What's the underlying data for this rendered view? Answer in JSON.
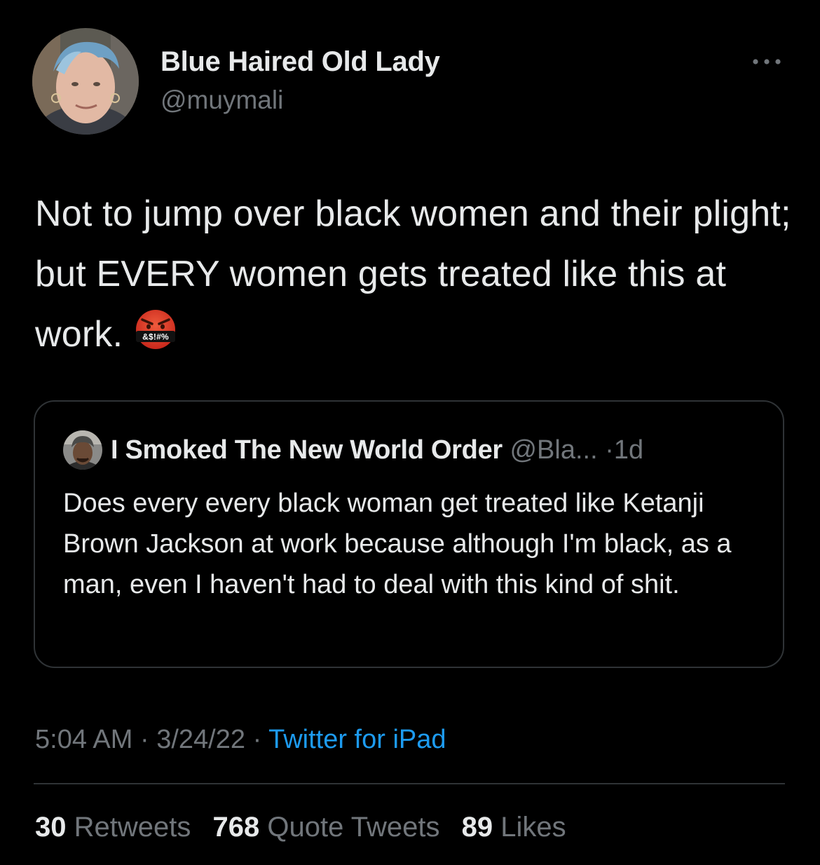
{
  "tweet": {
    "author": {
      "name": "Blue Haired Old Lady",
      "handle": "@muymali"
    },
    "text": "Not to jump over black women and their plight; but EVERY women gets treated like this at work.",
    "emoji_text": "&$!#%",
    "quoted": {
      "name": "I Smoked The New World Order",
      "handle": "@Bla...",
      "separator": "·",
      "time": "1d",
      "text": "Does every every black woman get treated like Ketanji Brown Jackson at work because although I'm black, as a man, even I haven't had to deal with this kind of shit."
    },
    "meta": {
      "time": "5:04 AM",
      "separator": "·",
      "date": "3/24/22",
      "source": "Twitter for iPad"
    },
    "stats": {
      "retweets_count": "30",
      "retweets_label": "Retweets",
      "quotes_count": "768",
      "quotes_label": "Quote Tweets",
      "likes_count": "89",
      "likes_label": "Likes"
    }
  },
  "icons": {
    "more": "more-icon",
    "emoji": "angry-emoji-icon"
  },
  "colors": {
    "background": "#000000",
    "text": "#e7e9ea",
    "secondary": "#71767b",
    "link": "#1d9bf0",
    "border": "#2f3336"
  }
}
